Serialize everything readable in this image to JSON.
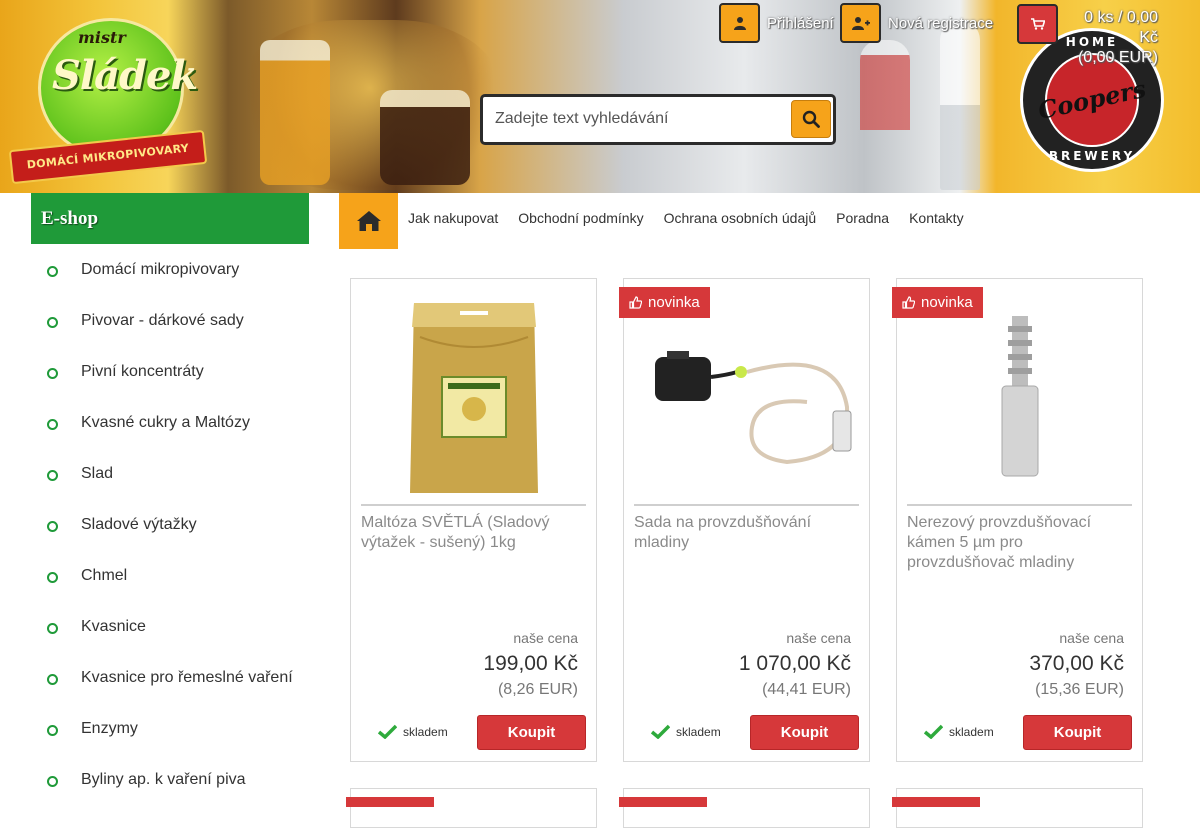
{
  "header": {
    "logo_left": {
      "top_text": "mistr",
      "main_text": "Sládek",
      "ribbon_text": "DOMÁCÍ MIKROPIVOVARY"
    },
    "logo_right": {
      "top_text": "HOME",
      "brand_text": "Coopers",
      "bottom_text": "BREWERY"
    },
    "login_label": "Přihlášení",
    "register_label": "Nová registrace",
    "cart": {
      "line1": "0 ks / 0,00 Kč",
      "line2": "(0,00 EUR)"
    },
    "search": {
      "placeholder": "Zadejte text vyhledávání",
      "value": ""
    },
    "icons": {
      "login": "user-icon",
      "register": "user-plus-icon",
      "cart": "cart-icon",
      "search": "search-icon"
    }
  },
  "sidebar": {
    "heading": "E-shop",
    "items": [
      {
        "label": "Domácí mikropivovary"
      },
      {
        "label": "Pivovar - dárkové sady"
      },
      {
        "label": "Pivní koncentráty"
      },
      {
        "label": "Kvasné cukry a Maltózy"
      },
      {
        "label": "Slad"
      },
      {
        "label": "Sladové výtažky"
      },
      {
        "label": "Chmel"
      },
      {
        "label": "Kvasnice"
      },
      {
        "label": "Kvasnice pro řemeslné vaření"
      },
      {
        "label": "Enzymy"
      },
      {
        "label": "Byliny ap. k vaření piva"
      }
    ]
  },
  "nav": {
    "home_icon": "home-icon",
    "items": [
      {
        "label": "Jak nakupovat"
      },
      {
        "label": "Obchodní podmínky"
      },
      {
        "label": "Ochrana osobních údajů"
      },
      {
        "label": "Poradna"
      },
      {
        "label": "Kontakty"
      }
    ]
  },
  "products": [
    {
      "badge": "",
      "title": "Maltóza SVĚTLÁ (Sladový výtažek - sušený) 1kg",
      "price_label": "naše cena",
      "price": "199,00 Kč",
      "price_eur": "(8,26 EUR)",
      "stock": "skladem",
      "buy_label": "Koupit"
    },
    {
      "badge": "novinka",
      "title": "Sada na provzdušňování mladiny",
      "price_label": "naše cena",
      "price": "1 070,00 Kč",
      "price_eur": "(44,41 EUR)",
      "stock": "skladem",
      "buy_label": "Koupit"
    },
    {
      "badge": "novinka",
      "title": "Nerezový provzdušňovací kámen 5 µm pro provzdušňovač mladiny",
      "price_label": "naše cena",
      "price": "370,00 Kč",
      "price_eur": "(15,36 EUR)",
      "stock": "skladem",
      "buy_label": "Koupit"
    }
  ],
  "colors": {
    "accent_orange": "#f6a31a",
    "sidebar_green": "#1f9a39",
    "buy_red": "#d6383a",
    "stock_green": "#2eaa3c"
  }
}
